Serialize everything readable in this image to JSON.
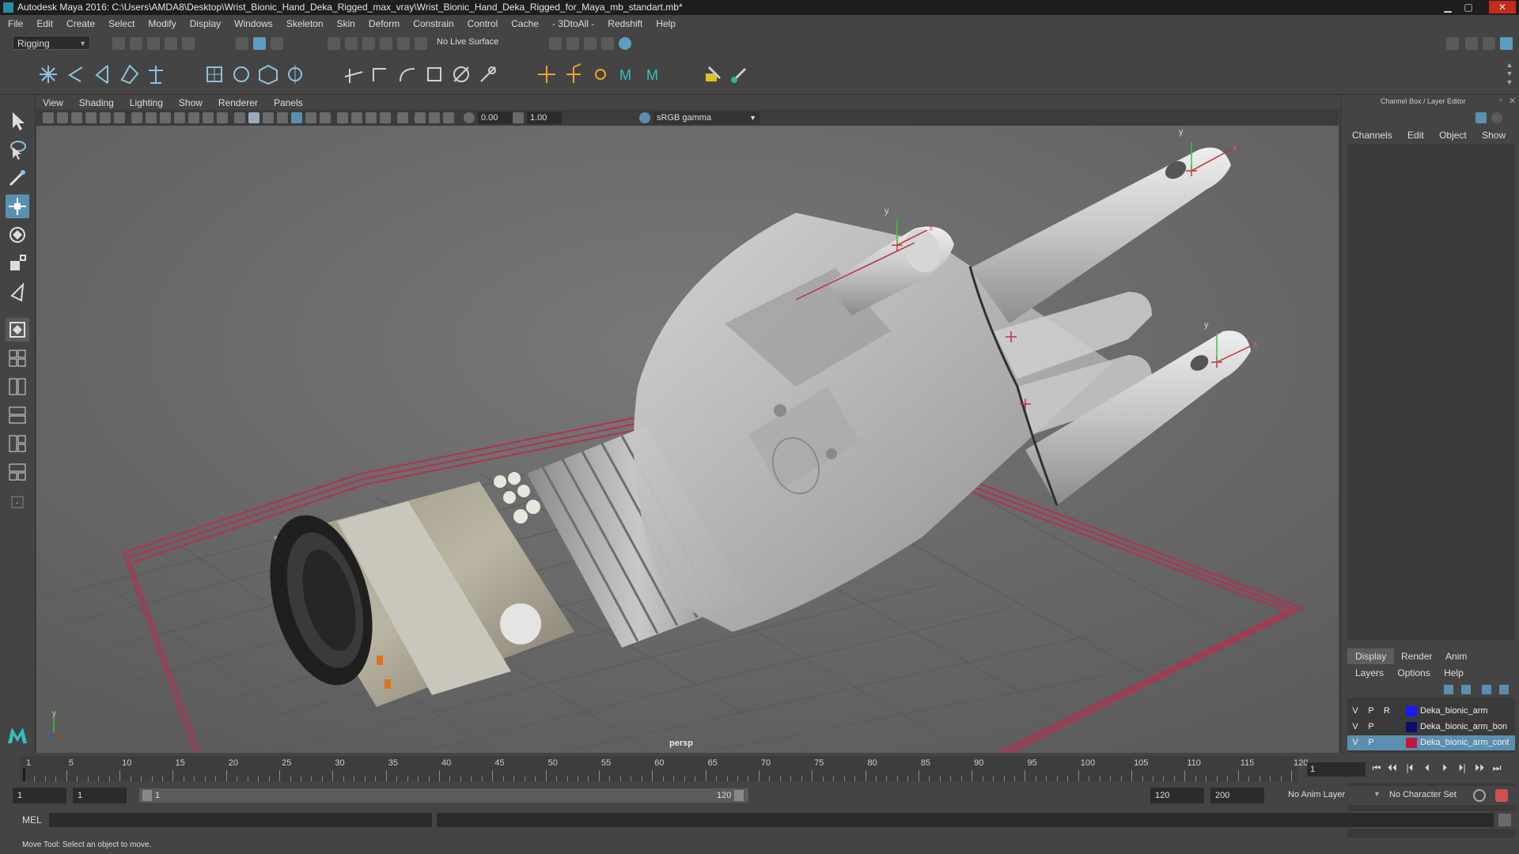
{
  "window": {
    "title": "Autodesk Maya 2016: C:\\Users\\AMDA8\\Desktop\\Wrist_Bionic_Hand_Deka_Rigged_max_vray\\Wrist_Bionic_Hand_Deka_Rigged_for_Maya_mb_standart.mb*",
    "minimize": "▁",
    "maximize": "▢",
    "close": "✕"
  },
  "menubar": [
    "File",
    "Edit",
    "Create",
    "Select",
    "Modify",
    "Display",
    "Windows",
    "Skeleton",
    "Skin",
    "Deform",
    "Constrain",
    "Control",
    "Cache",
    "- 3DtoAll -",
    "Redshift",
    "Help"
  ],
  "statusline": {
    "mode": "Rigging",
    "live_surface": "No Live Surface"
  },
  "viewport": {
    "menu": [
      "View",
      "Shading",
      "Lighting",
      "Show",
      "Renderer",
      "Panels"
    ],
    "exposure": "0.00",
    "gamma": "1.00",
    "color_space": "sRGB gamma",
    "camera_label": "persp",
    "axis_y": "y",
    "axis_x": "x"
  },
  "channel_box": {
    "title": "Channel Box / Layer Editor",
    "menu": [
      "Channels",
      "Edit",
      "Object",
      "Show"
    ],
    "layer_tabs": [
      "Display",
      "Render",
      "Anim"
    ],
    "layer_menu": [
      "Layers",
      "Options",
      "Help"
    ],
    "layers": [
      {
        "v": "V",
        "p": "P",
        "r": "R",
        "name": "Deka_bionic_arm",
        "color": "#1a1aff",
        "selected": false
      },
      {
        "v": "V",
        "p": "P",
        "r": "",
        "name": "Deka_bionic_arm_bon",
        "color": "#0b0b6e",
        "selected": false
      },
      {
        "v": "V",
        "p": "P",
        "r": "",
        "name": "Deka_bionic_arm_cont",
        "color": "#c4163c",
        "selected": true
      }
    ]
  },
  "timeline": {
    "tick_labels": [
      "1",
      "5",
      "10",
      "15",
      "20",
      "25",
      "30",
      "35",
      "40",
      "45",
      "50",
      "55",
      "60",
      "65",
      "70",
      "75",
      "80",
      "85",
      "90",
      "95",
      "100",
      "105",
      "110",
      "115",
      "120"
    ],
    "current_frame": "1",
    "playback_buttons": [
      "⏮",
      "⏴⏴",
      "|⏴",
      "⏴",
      "⏵",
      "⏵|",
      "⏵⏵",
      "⏭"
    ]
  },
  "range": {
    "start": "1",
    "inner_start": "1",
    "slider_start": "1",
    "slider_end": "120",
    "end": "120",
    "max": "200",
    "anim_layer": "No Anim Layer",
    "character_set": "No Character Set"
  },
  "command": {
    "label": "MEL"
  },
  "helpline": "Move Tool: Select an object to move."
}
